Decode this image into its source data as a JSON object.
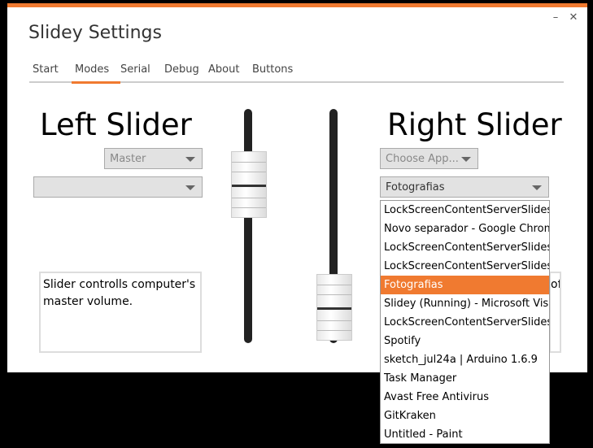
{
  "window": {
    "title": "Slidey Settings",
    "minimize_glyph": "–",
    "close_glyph": "✕",
    "accent_color": "#f07a30"
  },
  "tabs": [
    {
      "label": "Start"
    },
    {
      "label": "Modes",
      "active": true
    },
    {
      "label": "Serial"
    },
    {
      "label": "Debug"
    },
    {
      "label": "About"
    },
    {
      "label": "Buttons"
    }
  ],
  "left": {
    "heading": "Left Slider",
    "mode_select": "Master",
    "app_select": "",
    "description": "Slider controlls computer's master volume."
  },
  "right": {
    "heading": "Right Slider",
    "mode_select": "Choose App...",
    "app_select": "Fotografias",
    "description_fragment": "of"
  },
  "dropdown": {
    "selected_index": 4,
    "items": [
      "LockScreenContentServerSlideshow",
      "Novo separador - Google Chrome",
      "LockScreenContentServerSlideshow",
      "LockScreenContentServerSlideshow",
      "Fotografias",
      "Slidey (Running) - Microsoft Visual Studio",
      "LockScreenContentServerSlideshow",
      "Spotify",
      "sketch_jul24a | Arduino 1.6.9",
      "Task Manager",
      "Avast Free Antivirus",
      "GitKraken",
      "Untitled - Paint"
    ]
  }
}
